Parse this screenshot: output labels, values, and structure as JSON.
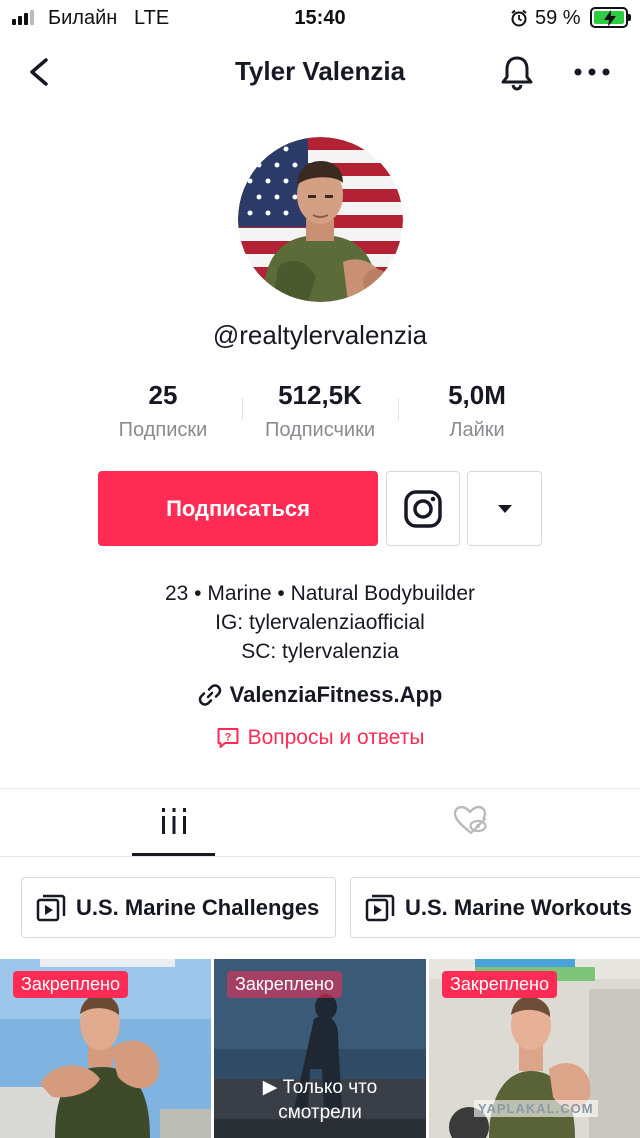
{
  "status_bar": {
    "carrier": "Билайн",
    "network": "LTE",
    "time": "15:40",
    "battery_percent": "59 %",
    "battery_level": 0.59
  },
  "nav": {
    "title": "Tyler Valenzia"
  },
  "profile": {
    "username": "@realtylervalenzia",
    "stats": [
      {
        "value": "25",
        "label": "Подписки"
      },
      {
        "value": "512,5K",
        "label": "Подписчики"
      },
      {
        "value": "5,0M",
        "label": "Лайки"
      }
    ],
    "follow_label": "Подписаться",
    "bio": [
      "23 • Marine • Natural Bodybuilder",
      "IG: tylervalenziaofficial",
      "SC: tylervalenzia"
    ],
    "link": "ValenziaFitness.App",
    "qa_label": "Вопросы и ответы"
  },
  "playlists": [
    {
      "label": "U.S. Marine Challenges"
    },
    {
      "label": "U.S. Marine Workouts"
    }
  ],
  "videos": [
    {
      "badge": "Закреплено"
    },
    {
      "badge": "Закреплено",
      "overlay": [
        "▶ Только что",
        "смотрели"
      ]
    },
    {
      "badge": "Закреплено"
    }
  ],
  "watermark": "YAPLAKAL.COM",
  "colors": {
    "accent": "#fe2c55",
    "text": "#161823",
    "muted": "#8a8b91"
  }
}
